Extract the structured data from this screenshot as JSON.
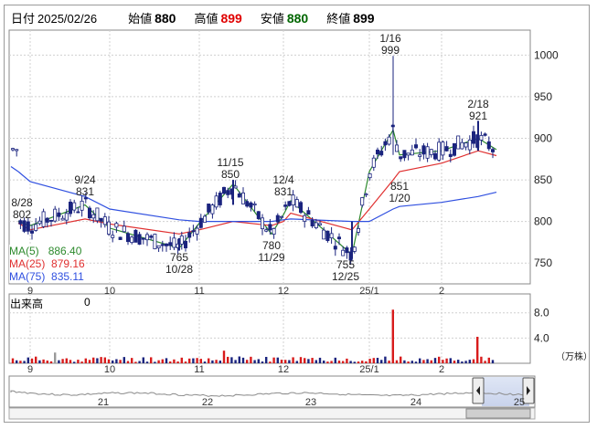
{
  "header": {
    "date_label": "日付",
    "date": "2025/02/26",
    "open_label": "始値",
    "open": "880",
    "high_label": "高値",
    "high": "899",
    "low_label": "安値",
    "low": "880",
    "close_label": "終値",
    "close": "899",
    "colors": {
      "high": "#e00000",
      "low": "#006600"
    }
  },
  "price_chart": {
    "y_ticks": [
      "1000",
      "950",
      "900",
      "850",
      "800",
      "750"
    ],
    "x_ticks": [
      "9",
      "10",
      "11",
      "12",
      "25/1",
      "2"
    ],
    "annotations": [
      {
        "text": [
          "8/28",
          "802"
        ]
      },
      {
        "text": [
          "9/24",
          "831"
        ]
      },
      {
        "text": [
          "11/15",
          "850"
        ]
      },
      {
        "text": [
          "12/4",
          "831"
        ]
      },
      {
        "text": [
          "1/16",
          "999"
        ]
      },
      {
        "text": [
          "2/18",
          "921"
        ]
      },
      {
        "text": [
          "765",
          "10/28"
        ]
      },
      {
        "text": [
          "780",
          "11/29"
        ]
      },
      {
        "text": [
          "755",
          "12/25"
        ]
      },
      {
        "text": [
          "851",
          "1/20"
        ]
      }
    ],
    "legend": [
      {
        "name": "MA(5)",
        "value": "886.40",
        "color": "#2d8a2d"
      },
      {
        "name": "MA(25)",
        "value": "879.16",
        "color": "#e03030"
      },
      {
        "name": "MA(75)",
        "value": "835.11",
        "color": "#3050e0"
      }
    ]
  },
  "volume_chart": {
    "title": "出来高",
    "current": "0",
    "y_ticks": [
      "8.0",
      "4.0"
    ],
    "unit": "（万株）",
    "x_ticks": [
      "9",
      "10",
      "11",
      "12",
      "25/1",
      "2"
    ]
  },
  "navigator": {
    "x_ticks": [
      "21",
      "22",
      "23",
      "24",
      "25"
    ]
  },
  "chart_data": {
    "type": "candlestick",
    "ylim": [
      725,
      1030
    ],
    "x": [
      "2024-08-28",
      "2024-09",
      "2024-09-24",
      "2024-10",
      "2024-10-28",
      "2024-11",
      "2024-11-15",
      "2024-11-29",
      "2024-12",
      "2024-12-04",
      "2024-12-25",
      "2025-01",
      "2025-01-16",
      "2025-01-20",
      "2025-02",
      "2025-02-18",
      "2025-02-26"
    ],
    "series": [
      {
        "name": "MA(5)",
        "values": [
          800,
          795,
          820,
          792,
          768,
          798,
          845,
          785,
          808,
          825,
          760,
          860,
          910,
          880,
          885,
          900,
          886.4
        ]
      },
      {
        "name": "MA(25)",
        "values": [
          798,
          790,
          803,
          797,
          785,
          790,
          800,
          795,
          800,
          810,
          790,
          815,
          850,
          860,
          870,
          885,
          879.16
        ]
      },
      {
        "name": "MA(75)",
        "values": [
          860,
          848,
          830,
          815,
          802,
          800,
          800,
          800,
          802,
          803,
          800,
          800,
          815,
          818,
          823,
          830,
          835.11
        ]
      }
    ],
    "marked_points": [
      {
        "date": "2024-08-28",
        "value": 802
      },
      {
        "date": "2024-09-24",
        "value": 831
      },
      {
        "date": "2024-10-28",
        "value": 765
      },
      {
        "date": "2024-11-15",
        "value": 850
      },
      {
        "date": "2024-11-29",
        "value": 780
      },
      {
        "date": "2024-12-04",
        "value": 831
      },
      {
        "date": "2024-12-25",
        "value": 755
      },
      {
        "date": "2025-01-16",
        "value": 999
      },
      {
        "date": "2025-01-20",
        "value": 851
      },
      {
        "date": "2025-02-18",
        "value": 921
      }
    ],
    "volume": {
      "ylim": [
        0,
        11
      ],
      "peaks": [
        {
          "date": "2025-01-16",
          "value": 8.5
        },
        {
          "date": "2025-02-18",
          "value": 4.2
        }
      ]
    }
  }
}
